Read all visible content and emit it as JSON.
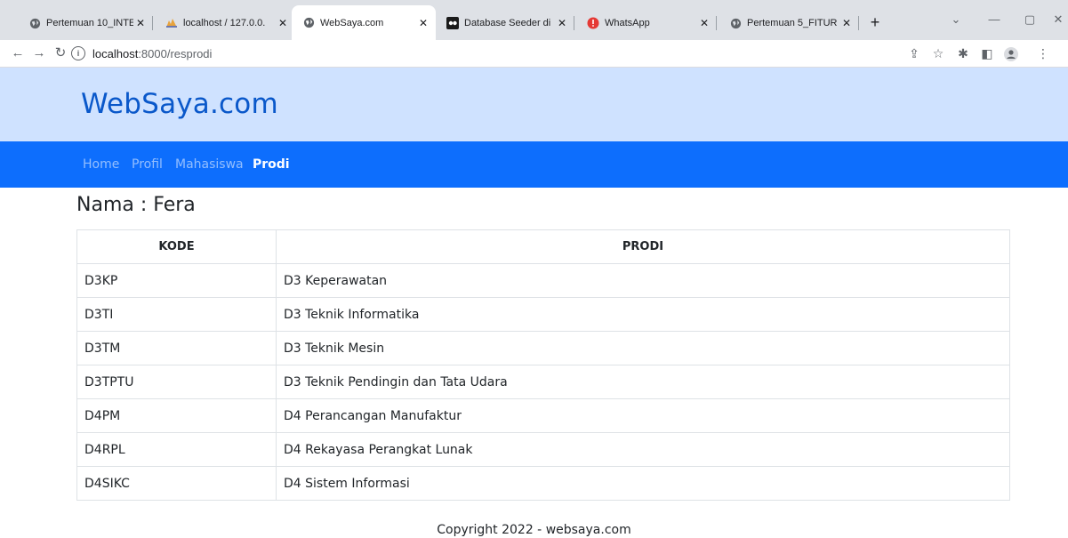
{
  "browser": {
    "tabs": [
      {
        "title": "Pertemuan 10_INTE",
        "icon": "globe-icon"
      },
      {
        "title": "localhost / 127.0.0.",
        "icon": "phpmyadmin-icon"
      },
      {
        "title": "WebSaya.com",
        "icon": "globe-icon",
        "active": true
      },
      {
        "title": "Database Seeder di",
        "icon": "app-icon"
      },
      {
        "title": "WhatsApp",
        "icon": "whatsapp-icon"
      },
      {
        "title": "Pertemuan 5_FITUR",
        "icon": "globe-icon"
      }
    ],
    "url_host": "localhost",
    "url_path": ":8000/resprodi"
  },
  "site": {
    "brand": "WebSaya.com",
    "nav": [
      "Home",
      "Profil",
      "Mahasiswa",
      "Prodi"
    ],
    "active_nav": "Prodi"
  },
  "main": {
    "heading": "Nama : Fera",
    "table": {
      "headers": [
        "KODE",
        "PRODI"
      ],
      "rows": [
        [
          "D3KP",
          "D3 Keperawatan"
        ],
        [
          "D3TI",
          "D3 Teknik Informatika"
        ],
        [
          "D3TM",
          "D3 Teknik Mesin"
        ],
        [
          "D3TPTU",
          "D3 Teknik Pendingin dan Tata Udara"
        ],
        [
          "D4PM",
          "D4 Perancangan Manufaktur"
        ],
        [
          "D4RPL",
          "D4 Rekayasa Perangkat Lunak"
        ],
        [
          "D4SIKC",
          "D4 Sistem Informasi"
        ]
      ]
    }
  },
  "footer": {
    "text": "Copyright 2022 - websaya.com"
  },
  "colors": {
    "header_bg": "#cfe2ff",
    "brand": "#0a58ca",
    "navbar_bg": "#0d6efd"
  }
}
